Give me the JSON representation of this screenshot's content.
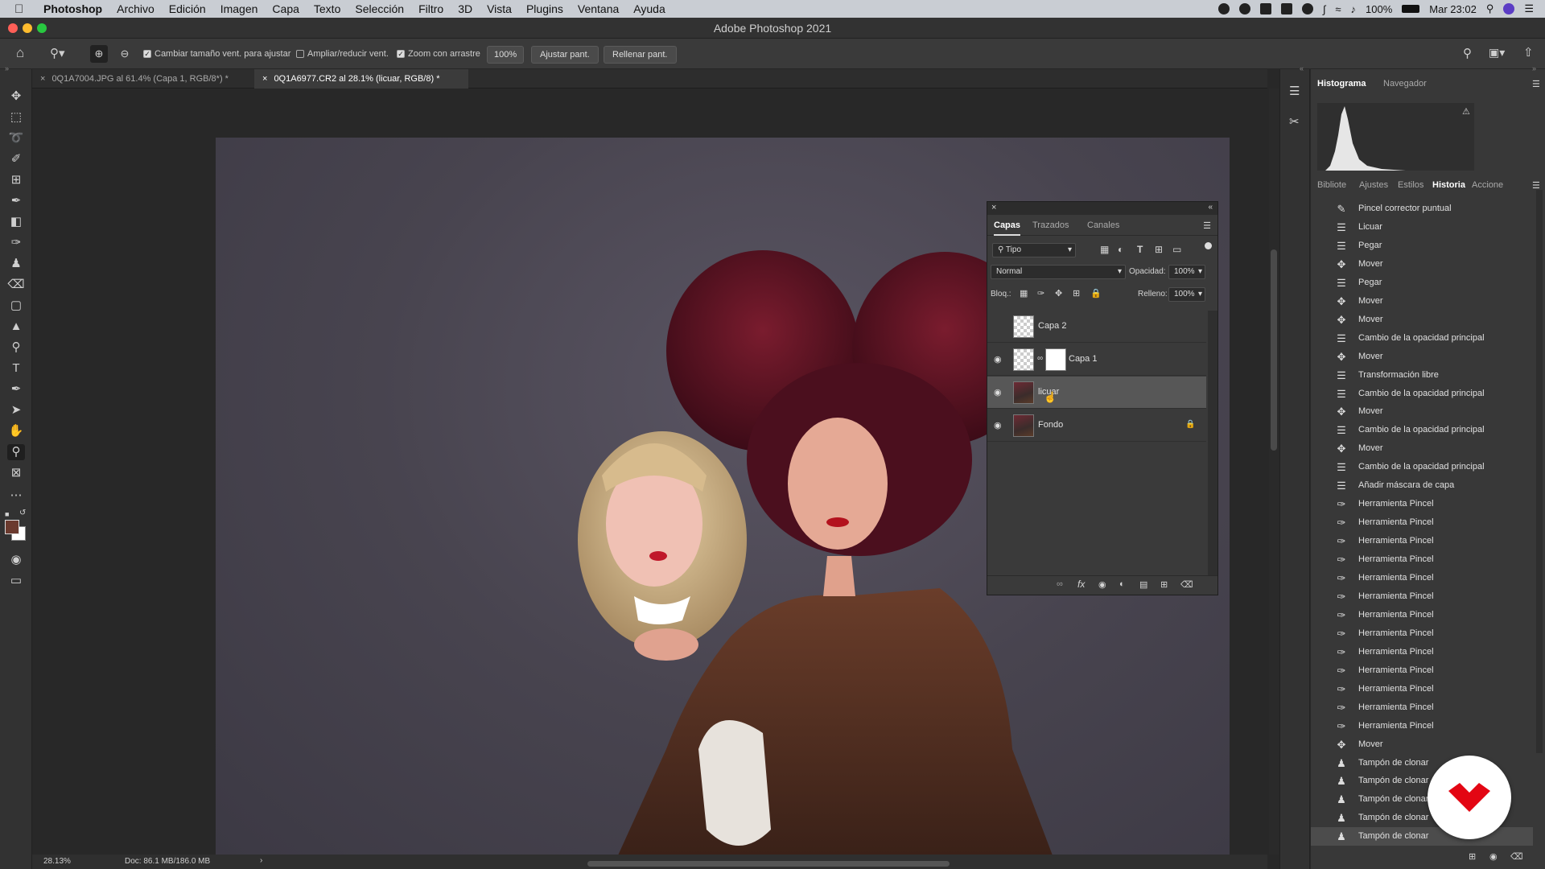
{
  "menubar": {
    "app": "Photoshop",
    "items": [
      "Archivo",
      "Edición",
      "Imagen",
      "Capa",
      "Texto",
      "Selección",
      "Filtro",
      "3D",
      "Vista",
      "Plugins",
      "Ventana",
      "Ayuda"
    ],
    "battery": "100%",
    "clock": "Mar 23:02"
  },
  "window": {
    "title": "Adobe Photoshop 2021"
  },
  "options": {
    "resize_windows": "Cambiar tamaño vent. para ajustar",
    "zoom_all": "Ampliar/reducir vent.",
    "scrubby_zoom": "Zoom con arrastre",
    "zoom_value": "100%",
    "fit_screen": "Ajustar pant.",
    "fill_screen": "Rellenar pant."
  },
  "tabs": [
    {
      "label": "0Q1A7004.JPG al 61.4% (Capa 1, RGB/8*) *"
    },
    {
      "label": "0Q1A6977.CR2 al 28.1% (licuar, RGB/8) *"
    }
  ],
  "status": {
    "zoom": "28.13%",
    "doc": "Doc: 86.1 MB/186.0 MB"
  },
  "layers_panel": {
    "tabs": [
      "Capas",
      "Trazados",
      "Canales"
    ],
    "filter": "Tipo",
    "blend_mode": "Normal",
    "opacity_label": "Opacidad:",
    "opacity": "100%",
    "lock_label": "Bloq.:",
    "fill_label": "Relleno:",
    "fill": "100%",
    "layers": [
      {
        "name": "Capa 2"
      },
      {
        "name": "Capa 1"
      },
      {
        "name": "licuar"
      },
      {
        "name": "Fondo"
      }
    ]
  },
  "right_panel": {
    "top_tabs": [
      "Histograma",
      "Navegador"
    ],
    "mid_tabs": [
      "Bibliote",
      "Ajustes",
      "Estilos",
      "Historia",
      "Accione"
    ]
  },
  "history": [
    {
      "icon": "healing-icon",
      "label": "Pincel corrector puntual"
    },
    {
      "icon": "doc-icon",
      "label": "Licuar"
    },
    {
      "icon": "doc-icon",
      "label": "Pegar"
    },
    {
      "icon": "move-icon",
      "label": "Mover"
    },
    {
      "icon": "doc-icon",
      "label": "Pegar"
    },
    {
      "icon": "move-icon",
      "label": "Mover"
    },
    {
      "icon": "move-icon",
      "label": "Mover"
    },
    {
      "icon": "doc-icon",
      "label": "Cambio de la opacidad principal"
    },
    {
      "icon": "move-icon",
      "label": "Mover"
    },
    {
      "icon": "doc-icon",
      "label": "Transformación libre"
    },
    {
      "icon": "doc-icon",
      "label": "Cambio de la opacidad principal"
    },
    {
      "icon": "move-icon",
      "label": "Mover"
    },
    {
      "icon": "doc-icon",
      "label": "Cambio de la opacidad principal"
    },
    {
      "icon": "move-icon",
      "label": "Mover"
    },
    {
      "icon": "doc-icon",
      "label": "Cambio de la opacidad principal"
    },
    {
      "icon": "doc-icon",
      "label": "Añadir máscara de capa"
    },
    {
      "icon": "brush-icon",
      "label": "Herramienta Pincel"
    },
    {
      "icon": "brush-icon",
      "label": "Herramienta Pincel"
    },
    {
      "icon": "brush-icon",
      "label": "Herramienta Pincel"
    },
    {
      "icon": "brush-icon",
      "label": "Herramienta Pincel"
    },
    {
      "icon": "brush-icon",
      "label": "Herramienta Pincel"
    },
    {
      "icon": "brush-icon",
      "label": "Herramienta Pincel"
    },
    {
      "icon": "brush-icon",
      "label": "Herramienta Pincel"
    },
    {
      "icon": "brush-icon",
      "label": "Herramienta Pincel"
    },
    {
      "icon": "brush-icon",
      "label": "Herramienta Pincel"
    },
    {
      "icon": "brush-icon",
      "label": "Herramienta Pincel"
    },
    {
      "icon": "brush-icon",
      "label": "Herramienta Pincel"
    },
    {
      "icon": "brush-icon",
      "label": "Herramienta Pincel"
    },
    {
      "icon": "brush-icon",
      "label": "Herramienta Pincel"
    },
    {
      "icon": "move-icon",
      "label": "Mover"
    },
    {
      "icon": "stamp-icon",
      "label": "Tampón de clonar"
    },
    {
      "icon": "stamp-icon",
      "label": "Tampón de clonar"
    },
    {
      "icon": "stamp-icon",
      "label": "Tampón de clonar"
    },
    {
      "icon": "stamp-icon",
      "label": "Tampón de clonar"
    },
    {
      "icon": "stamp-icon",
      "label": "Tampón de clonar"
    }
  ],
  "colors": {
    "accent": "#e30613",
    "foreground_swatch": "#6b3a2e",
    "background_swatch": "#ffffff"
  }
}
